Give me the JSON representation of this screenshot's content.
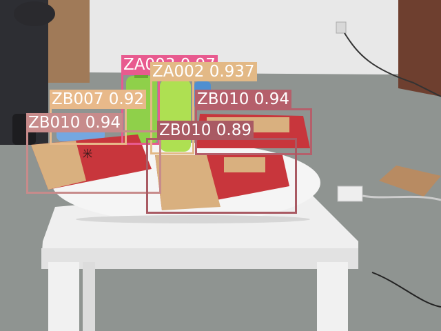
{
  "image": {
    "kind": "photo",
    "scene": "indoor room, snack bags and drink bottles on a round white tray on a small white table",
    "background_colors": {
      "wall": "#e8e8e8",
      "floor": "#8f9491",
      "table": "#eeeeee",
      "tray": "#f4f4f4",
      "bag_red": "#c8363c",
      "bag_kraft": "#d9b07f"
    }
  },
  "detections": [
    {
      "id": "ZA003",
      "class": "ZA003",
      "score": "0.97",
      "label": "ZA003 0.97",
      "color": "#e85a8f"
    },
    {
      "id": "ZA002",
      "class": "ZA002",
      "score": "0.937",
      "label": "ZA002 0.937",
      "color": "#e3b986"
    },
    {
      "id": "ZB007",
      "class": "ZB007",
      "score": "0.92",
      "label": "ZB007 0.92",
      "color": "#e8b98a"
    },
    {
      "id": "ZB010a",
      "class": "ZB010",
      "score": "0.94",
      "label": "ZB010 0.94",
      "color": "#b55f6b"
    },
    {
      "id": "ZB010b",
      "class": "ZB010",
      "score": "0.94",
      "label": "ZB010 0.94",
      "color": "#c78b8b"
    },
    {
      "id": "ZB010c",
      "class": "ZB010",
      "score": "0.89",
      "label": "ZB010 0.89",
      "color": "#a95a63"
    }
  ]
}
